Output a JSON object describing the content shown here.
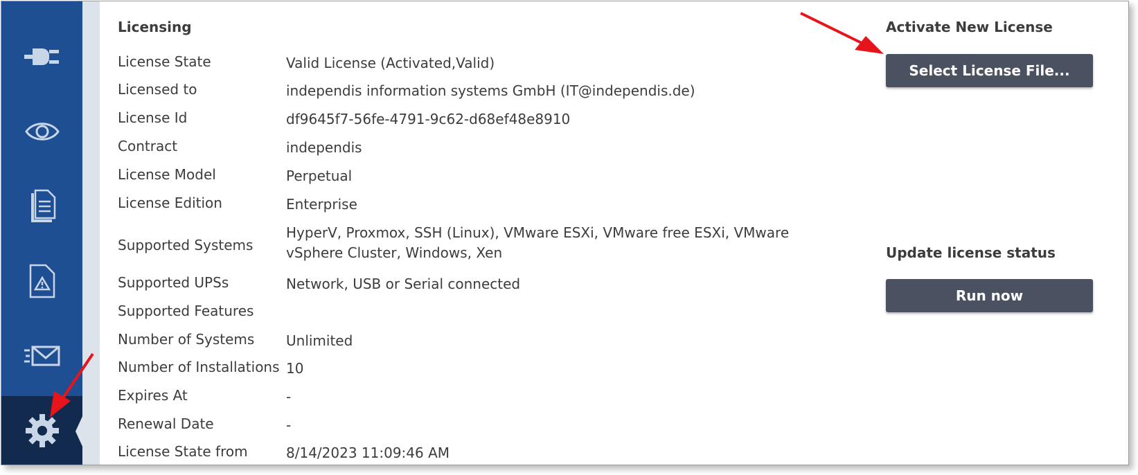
{
  "sidebar": {
    "items": [
      {
        "icon": "plug-icon",
        "active": false
      },
      {
        "icon": "eye-icon",
        "active": false
      },
      {
        "icon": "document-icon",
        "active": false
      },
      {
        "icon": "warning-document-icon",
        "active": false
      },
      {
        "icon": "mail-icon",
        "active": false
      },
      {
        "icon": "gear-icon",
        "active": true
      }
    ]
  },
  "licensing": {
    "title": "Licensing",
    "rows": [
      {
        "label": "License State",
        "value": "Valid License (Activated,Valid)"
      },
      {
        "label": "Licensed to",
        "value": "independis information systems GmbH (IT@independis.de)"
      },
      {
        "label": "License Id",
        "value": "df9645f7-56fe-4791-9c62-d68ef48e8910"
      },
      {
        "label": "Contract",
        "value": "independis"
      },
      {
        "label": "License Model",
        "value": "Perpetual"
      },
      {
        "label": "License Edition",
        "value": "Enterprise"
      },
      {
        "label": "Supported Systems",
        "value": "HyperV, Proxmox, SSH (Linux), VMware ESXi, VMware free ESXi, VMware vSphere Cluster, Windows, Xen"
      },
      {
        "label": "Supported UPSs",
        "value": "Network, USB or Serial connected"
      },
      {
        "label": "Supported Features",
        "value": ""
      },
      {
        "label": "Number of Systems",
        "value": "Unlimited"
      },
      {
        "label": "Number of Installations",
        "value": "10"
      },
      {
        "label": "Expires At",
        "value": "-"
      },
      {
        "label": "Renewal Date",
        "value": "-"
      },
      {
        "label": "License State from",
        "value": "8/14/2023 11:09:46 AM"
      }
    ]
  },
  "activate": {
    "title": "Activate New License",
    "button_label": "Select License File..."
  },
  "update": {
    "title": "Update license status",
    "button_label": "Run now"
  },
  "colors": {
    "sidebar": "#1e4f93",
    "sidebar_active": "#122a4d",
    "button": "#4a5261",
    "annotation_arrow": "#e8141b"
  }
}
